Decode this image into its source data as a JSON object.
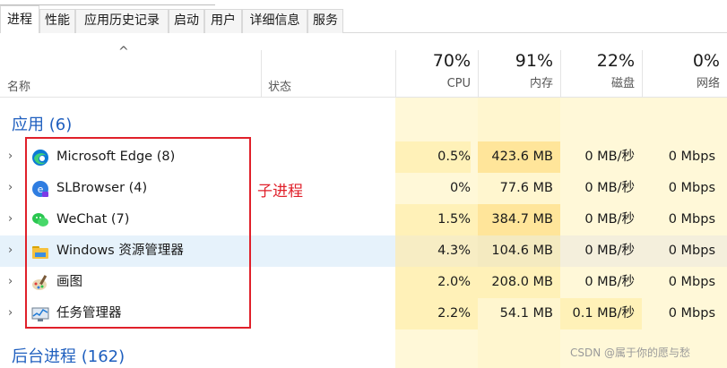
{
  "tabs": [
    {
      "label": "进程",
      "active": true
    },
    {
      "label": "性能",
      "active": false
    },
    {
      "label": "应用历史记录",
      "active": false
    },
    {
      "label": "启动",
      "active": false
    },
    {
      "label": "用户",
      "active": false
    },
    {
      "label": "详细信息",
      "active": false
    },
    {
      "label": "服务",
      "active": false
    }
  ],
  "header": {
    "sort_glyph": "^",
    "name_label": "名称",
    "status_label": "状态",
    "columns": [
      {
        "pct": "70%",
        "label": "CPU"
      },
      {
        "pct": "91%",
        "label": "内存"
      },
      {
        "pct": "22%",
        "label": "磁盘"
      },
      {
        "pct": "0%",
        "label": "网络"
      }
    ]
  },
  "groups": {
    "apps": "应用 (6)",
    "background": "后台进程 (162)"
  },
  "rows": [
    {
      "name": "Microsoft Edge (8)",
      "icon": "edge-icon",
      "cpu": "0.5%",
      "mem": "423.6 MB",
      "disk": "0 MB/秒",
      "net": "0 Mbps",
      "highlight": false
    },
    {
      "name": "SLBrowser (4)",
      "icon": "slbrowser-icon",
      "cpu": "0%",
      "mem": "77.6 MB",
      "disk": "0 MB/秒",
      "net": "0 Mbps",
      "highlight": false
    },
    {
      "name": "WeChat (7)",
      "icon": "wechat-icon",
      "cpu": "1.5%",
      "mem": "384.7 MB",
      "disk": "0 MB/秒",
      "net": "0 Mbps",
      "highlight": false
    },
    {
      "name": "Windows 资源管理器",
      "icon": "folder-icon",
      "cpu": "4.3%",
      "mem": "104.6 MB",
      "disk": "0 MB/秒",
      "net": "0 Mbps",
      "highlight": true
    },
    {
      "name": "画图",
      "icon": "paint-icon",
      "cpu": "2.0%",
      "mem": "208.0 MB",
      "disk": "0 MB/秒",
      "net": "0 Mbps",
      "highlight": false
    },
    {
      "name": "任务管理器",
      "icon": "task-manager-icon",
      "cpu": "2.2%",
      "mem": "54.1 MB",
      "disk": "0.1 MB/秒",
      "net": "0 Mbps",
      "highlight": false
    }
  ],
  "annotation": "子进程",
  "watermark": "CSDN @属于你的愿与愁",
  "colors": {
    "accent": "#1f5fbf",
    "annotation_red": "#e0202a",
    "heat_light": "#fff8d8",
    "heat_mid": "#fff1b8",
    "heat_strong": "#ffe59a",
    "row_highlight": "#e6f2fb"
  }
}
